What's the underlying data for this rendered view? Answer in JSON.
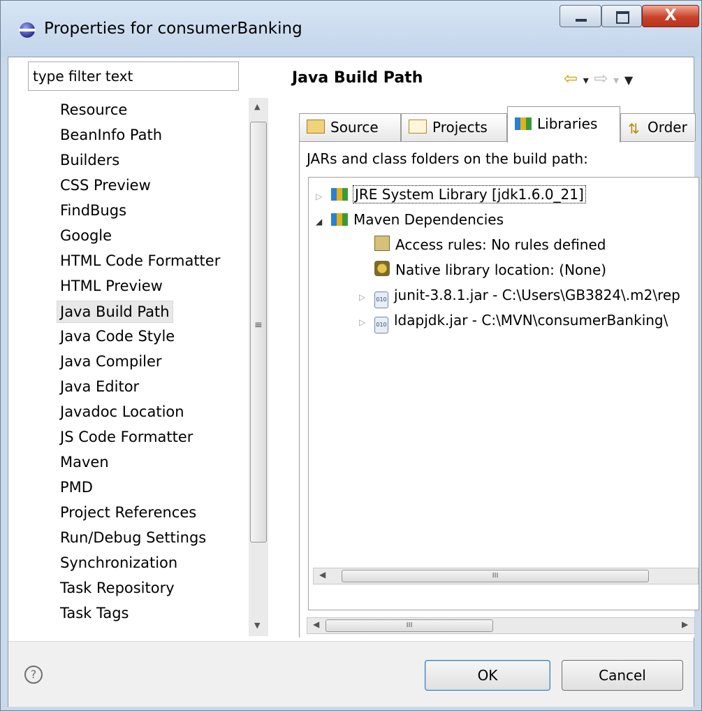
{
  "window": {
    "title": "Properties for consumerBanking",
    "controls": {
      "minimize": "minimize-icon",
      "maximize": "maximize-icon",
      "close": "close-icon",
      "close_glyph": "X"
    }
  },
  "filter": {
    "value": "type filter text"
  },
  "nav": {
    "items": [
      "Resource",
      "BeanInfo Path",
      "Builders",
      "CSS Preview",
      "FindBugs",
      "Google",
      "HTML Code Formatter",
      "HTML Preview",
      "Java Build Path",
      "Java Code Style",
      "Java Compiler",
      "Java Editor",
      "Javadoc Location",
      "JS Code Formatter",
      "Maven",
      "PMD",
      "Project References",
      "Run/Debug Settings",
      "Synchronization",
      "Task Repository",
      "Task Tags"
    ],
    "selected": "Java Build Path",
    "scroll_glyph": "≡"
  },
  "page": {
    "title": "Java Build Path",
    "back_glyph": "⇦",
    "forward_glyph": "⇨",
    "dropdown_glyph": "▾",
    "menu_glyph": "▼"
  },
  "tabs": [
    {
      "label": "Source",
      "icon": "source-folder-icon"
    },
    {
      "label": "Projects",
      "icon": "project-folder-icon"
    },
    {
      "label": "Libraries",
      "icon": "library-icon",
      "active": true
    },
    {
      "label": "Order",
      "icon": "order-export-icon"
    }
  ],
  "libraries": {
    "label": "JARs and class folders on the build path:",
    "tree": [
      {
        "label": "JRE System Library [jdk1.6.0_21]",
        "icon": "library-icon",
        "expanded": false
      },
      {
        "label": "Maven Dependencies",
        "icon": "library-icon",
        "expanded": true
      },
      {
        "label": "Access rules: No rules defined",
        "icon": "access-rules-icon"
      },
      {
        "label": "Native library location: (None)",
        "icon": "native-library-icon"
      },
      {
        "label": "junit-3.8.1.jar - C:\\Users\\GB3824\\.m2\\rep",
        "icon": "jar-icon",
        "expanded": false
      },
      {
        "label": "ldapjdk.jar - C:\\MVN\\consumerBanking\\",
        "icon": "jar-icon",
        "expanded": false
      }
    ],
    "scroll_grip": "III"
  },
  "buttons": {
    "ok": "OK",
    "cancel": "Cancel",
    "help_glyph": "?"
  }
}
